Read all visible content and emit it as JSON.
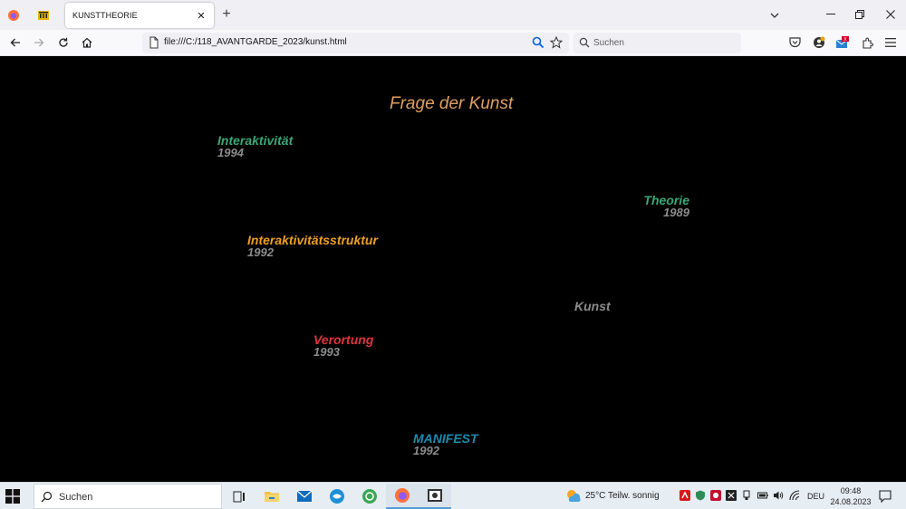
{
  "browser": {
    "tab_title": "KUNSTTHEORIE",
    "url": "file:///C:/118_AVANTGARDE_2023/kunst.html",
    "search_placeholder": "Suchen"
  },
  "page": {
    "heading": "Frage der Kunst",
    "entries": [
      {
        "label": "Interaktivität",
        "year": "1994",
        "color": "#3aa876"
      },
      {
        "label": "Theorie",
        "year": "1989",
        "color": "#3aa876"
      },
      {
        "label": "Interaktivitätsstruktur",
        "year": "1992",
        "color": "#f0a020"
      },
      {
        "label": "Kunst",
        "year": "",
        "color": "#8c8c8c"
      },
      {
        "label": "Verortung",
        "year": "1993",
        "color": "#e0333a"
      },
      {
        "label": "MANIFEST",
        "year": "1992",
        "color": "#1a8cb0"
      }
    ]
  },
  "taskbar": {
    "search_placeholder": "Suchen",
    "weather": "25°C  Teilw. sonnig",
    "language": "DEU",
    "time": "09:48",
    "date": "24.08.2023"
  }
}
